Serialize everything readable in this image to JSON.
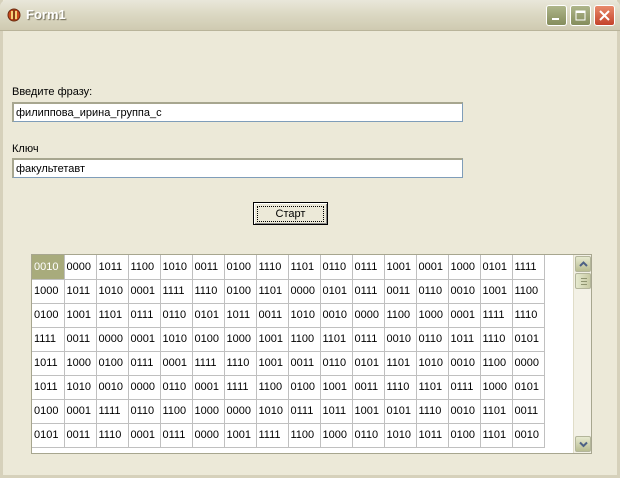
{
  "window": {
    "title": "Form1"
  },
  "form": {
    "phrase_label": "Введите фразу:",
    "phrase_value": "филиппова_ирина_группа_с",
    "key_label": "Ключ",
    "key_value": "факультетавт",
    "start_label": "Старт"
  },
  "grid": {
    "selected": [
      0,
      0
    ],
    "rows": [
      [
        "0010",
        "0000",
        "1011",
        "1100",
        "1010",
        "0011",
        "0100",
        "1110",
        "1101",
        "0110",
        "0111",
        "1001",
        "0001",
        "1000",
        "0101",
        "1111"
      ],
      [
        "1000",
        "1011",
        "1010",
        "0001",
        "1111",
        "1110",
        "0100",
        "1101",
        "0000",
        "0101",
        "0111",
        "0011",
        "0110",
        "0010",
        "1001",
        "1100"
      ],
      [
        "0100",
        "1001",
        "1101",
        "0111",
        "0110",
        "0101",
        "1011",
        "0011",
        "1010",
        "0010",
        "0000",
        "1100",
        "1000",
        "0001",
        "1111",
        "1110"
      ],
      [
        "1111",
        "0011",
        "0000",
        "0001",
        "1010",
        "0100",
        "1000",
        "1001",
        "1100",
        "1101",
        "0111",
        "0010",
        "0110",
        "1011",
        "1110",
        "0101"
      ],
      [
        "1011",
        "1000",
        "0100",
        "0111",
        "0001",
        "1111",
        "1110",
        "1001",
        "0011",
        "0110",
        "0101",
        "1101",
        "1010",
        "0010",
        "1100",
        "0000"
      ],
      [
        "1011",
        "1010",
        "0010",
        "0000",
        "0110",
        "0001",
        "1111",
        "1100",
        "0100",
        "1001",
        "0011",
        "1110",
        "1101",
        "0111",
        "1000",
        "0101"
      ],
      [
        "0100",
        "0001",
        "1111",
        "0110",
        "1100",
        "1000",
        "0000",
        "1010",
        "0111",
        "1011",
        "1001",
        "0101",
        "1110",
        "0010",
        "1101",
        "0011"
      ],
      [
        "0101",
        "0011",
        "1110",
        "0001",
        "0111",
        "0000",
        "1001",
        "1111",
        "1100",
        "1000",
        "0110",
        "1010",
        "1011",
        "0100",
        "1101",
        "0010"
      ]
    ]
  },
  "icons": {
    "app": "delphi-app-icon",
    "scroll_up": "chevron-up-icon",
    "scroll_down": "chevron-down-icon"
  }
}
